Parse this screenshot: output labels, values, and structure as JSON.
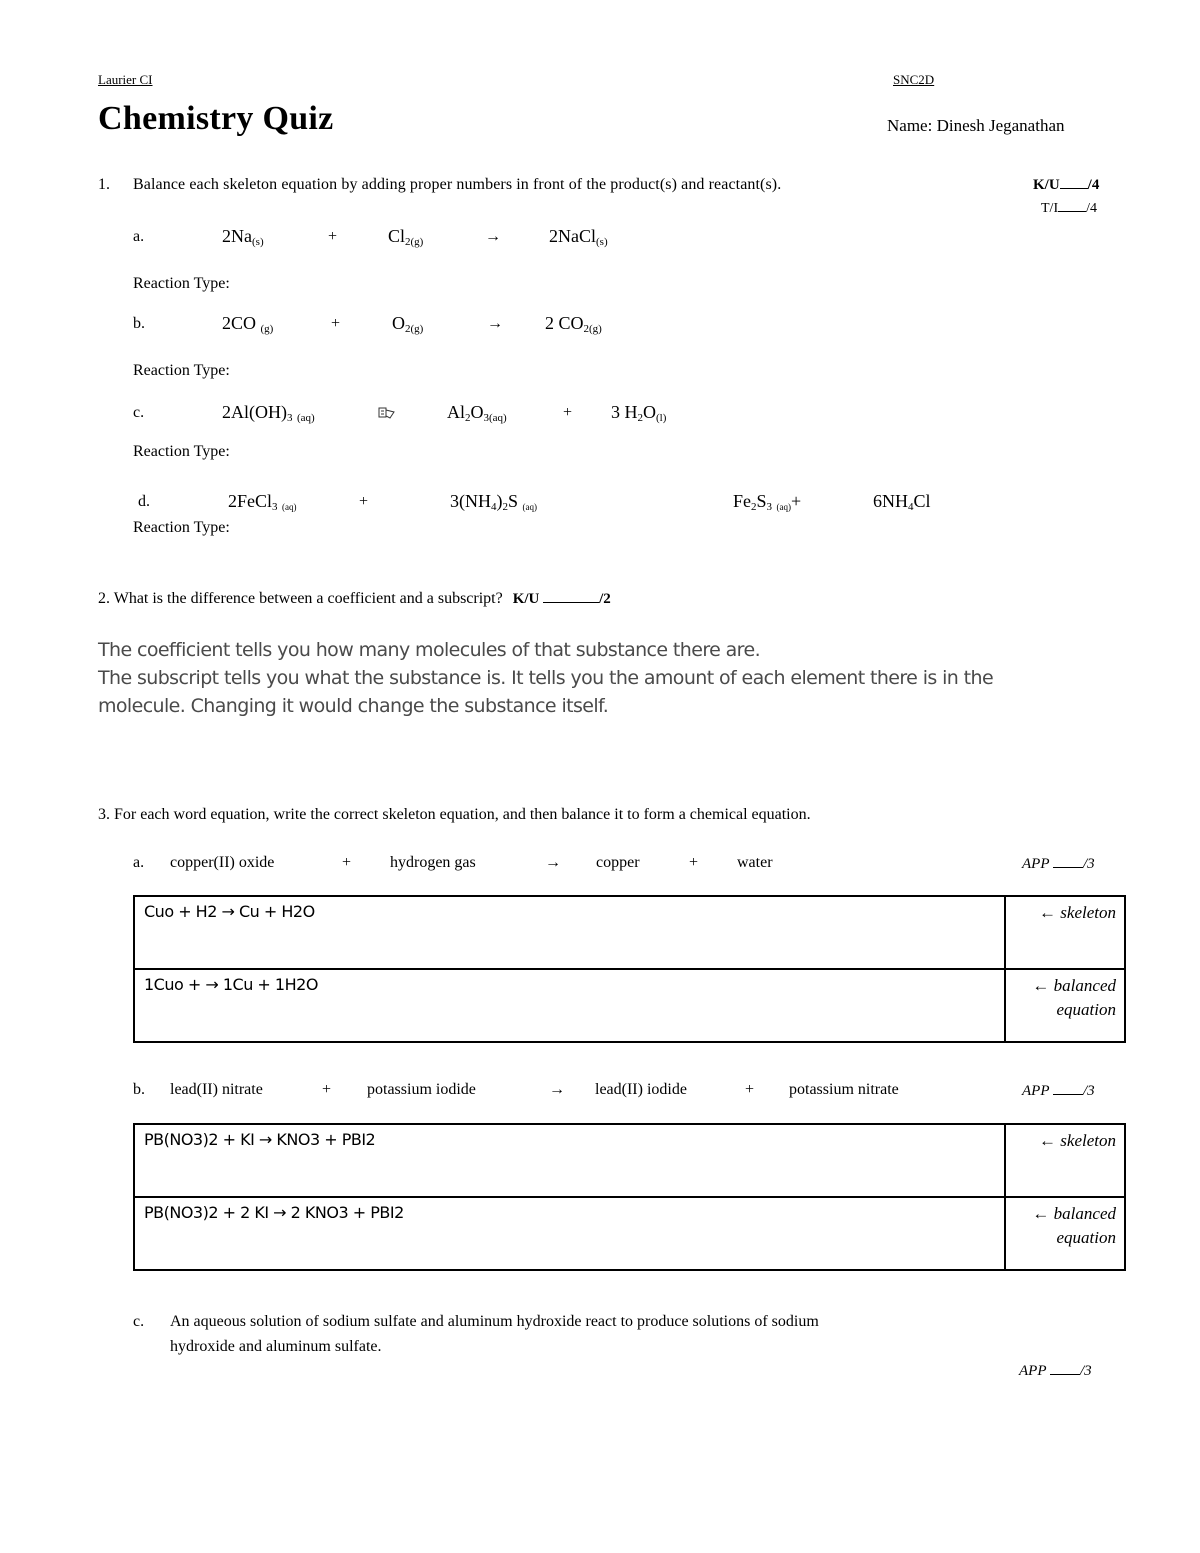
{
  "header": {
    "school": "Laurier CI",
    "course": "SNC2D",
    "title": "Chemistry Quiz",
    "name_label": "Name: Dinesh Jeganathan"
  },
  "q1": {
    "number": "1.",
    "prompt": "Balance each skeleton equation by adding proper numbers in front of the product(s) and reactant(s).",
    "marks": [
      {
        "label": "K/U",
        "total": "/4"
      },
      {
        "label": "T/I",
        "total": "/4"
      }
    ],
    "reaction_type_label": "Reaction Type:",
    "items": [
      {
        "letter": "a.",
        "r1": "2Na",
        "r1_state": "(s)",
        "plus1": "+",
        "r2": "Cl",
        "r2_sub": "2",
        "r2_state": "(g)",
        "arrow": "→",
        "p1": "2NaCl",
        "p1_state": "(s)"
      },
      {
        "letter": "b.",
        "r1": "2CO",
        "r1_state": "(g)",
        "plus1": "+",
        "r2": "O",
        "r2_sub": "2",
        "r2_state": "(g)",
        "arrow": "→",
        "p1": "2 CO",
        "p1_sub": "2",
        "p1_state": "(g)"
      },
      {
        "letter": "c.",
        "r1": "2Al(OH)",
        "r1_sub": "3",
        "r1_state": "(aq)",
        "arrow_icon": "missing-glyph-icon",
        "p1": "Al",
        "p1_sub": "2",
        "p1_mid": "O",
        "p1_sub2": "3",
        "p1_state": "(aq)",
        "plus": "+",
        "p2": "3  H",
        "p2_sub": "2",
        "p2_mid": "O",
        "p2_state": "(l)"
      },
      {
        "letter": "d.",
        "r1": "2FeCl",
        "r1_sub": "3",
        "r1_state": "(aq)",
        "plus1": "+",
        "r2": "3(NH",
        "r2_sub": "4",
        "r2_mid": ")",
        "r2_sub2": "2",
        "r2_end": "S",
        "r2_state": "(aq)",
        "p1": "Fe",
        "p1_sub": "2",
        "p1_mid": "S",
        "p1_sub2": "3",
        "p1_state": "(aq)",
        "plus2": "+",
        "p2": "6NH",
        "p2_sub": "4",
        "p2_end": "Cl"
      }
    ]
  },
  "q2": {
    "prompt": "2. What is the difference between a coefficient and a subscript?",
    "mark_label": "K/U",
    "mark_total": "/2",
    "answer_lines": [
      "The coefficient tells you how many molecules of that substance there are.",
      "The subscript tells you what the substance is. It tells you the amount of each element there is in the molecule. Changing it would change the substance itself."
    ]
  },
  "q3": {
    "prompt": "3. For each word equation, write the correct skeleton equation, and then balance it to form a chemical equation.",
    "items": [
      {
        "letter": "a.",
        "words": [
          "copper(II) oxide",
          "+",
          "hydrogen gas",
          "→",
          "copper",
          "+",
          "water"
        ],
        "mark_label": "APP",
        "mark_total": "/3",
        "skeleton": "Cuo + H2 → Cu + H2O",
        "balanced": "1Cuo +  →  1Cu + 1H2O",
        "skeleton_label": "← skeleton",
        "balanced_label_1": "← balanced",
        "balanced_label_2": "equation"
      },
      {
        "letter": "b.",
        "words": [
          "lead(II) nitrate",
          "+",
          "potassium iodide",
          "→",
          "lead(II) iodide",
          "+",
          "potassium nitrate"
        ],
        "mark_label": "APP",
        "mark_total": "/3",
        "skeleton": "PB(NO3)2 + KI  →  KNO3 + PBI2",
        "balanced": "PB(NO3)2 + 2 KI  → 2 KNO3 + PBI2",
        "skeleton_label": "← skeleton",
        "balanced_label_1": "← balanced",
        "balanced_label_2": "equation"
      },
      {
        "letter": "c.",
        "text_line1": "An aqueous solution of sodium sulfate and aluminum hydroxide react to produce solutions of sodium",
        "text_line2": "hydroxide and aluminum sulfate.",
        "mark_label": "APP",
        "mark_total": "/3"
      }
    ]
  }
}
